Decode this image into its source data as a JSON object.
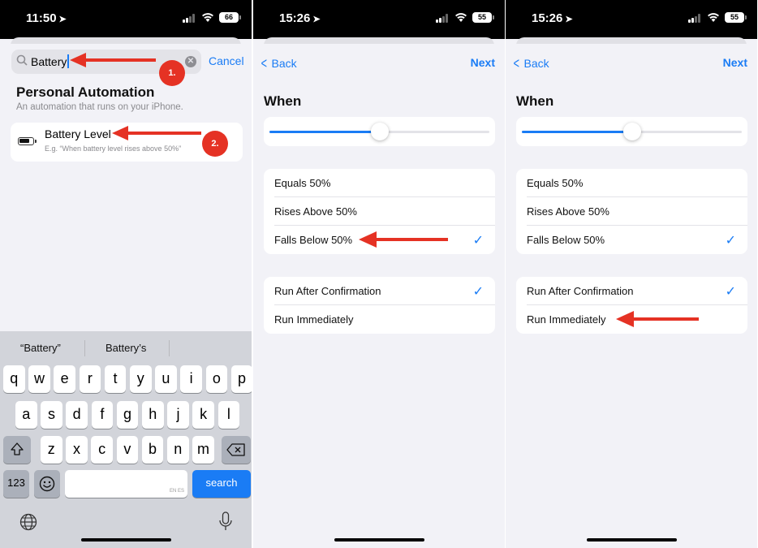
{
  "colors": {
    "accent": "#1a7cf5",
    "annotation_red": "#e53224"
  },
  "panel1": {
    "status": {
      "time": "11:50",
      "battery": "66"
    },
    "search": {
      "query": "Battery",
      "cancel": "Cancel"
    },
    "section": {
      "title": "Personal Automation",
      "subtitle": "An automation that runs on your iPhone."
    },
    "result": {
      "title": "Battery Level",
      "subtitle": "E.g. “When battery level rises above 50%”"
    },
    "annotations": {
      "step1": "1.",
      "step2": "2."
    },
    "keyboard": {
      "suggestions": [
        "“Battery”",
        "Battery’s"
      ],
      "row1": [
        "q",
        "w",
        "e",
        "r",
        "t",
        "y",
        "u",
        "i",
        "o",
        "p"
      ],
      "row2": [
        "a",
        "s",
        "d",
        "f",
        "g",
        "h",
        "j",
        "k",
        "l"
      ],
      "row3": [
        "z",
        "x",
        "c",
        "v",
        "b",
        "n",
        "m"
      ],
      "numbers_key": "123",
      "search_key": "search",
      "space_hint": "EN ES",
      "icons": [
        "shift-icon",
        "delete-icon",
        "emoji-icon",
        "globe-icon",
        "microphone-icon"
      ]
    }
  },
  "panel2": {
    "status": {
      "time": "15:26",
      "battery": "55"
    },
    "nav": {
      "back": "Back",
      "next": "Next"
    },
    "when": "When",
    "slider_fraction": 0.5,
    "conditions": [
      "Equals 50%",
      "Rises Above 50%",
      "Falls Below 50%"
    ],
    "condition_selected": 2,
    "run_options": [
      "Run After Confirmation",
      "Run Immediately"
    ],
    "run_selected": 0
  },
  "panel3": {
    "status": {
      "time": "15:26",
      "battery": "55"
    },
    "nav": {
      "back": "Back",
      "next": "Next"
    },
    "when": "When",
    "slider_fraction": 0.5,
    "conditions": [
      "Equals 50%",
      "Rises Above 50%",
      "Falls Below 50%"
    ],
    "condition_selected": 2,
    "run_options": [
      "Run After Confirmation",
      "Run Immediately"
    ],
    "run_selected": 0
  }
}
